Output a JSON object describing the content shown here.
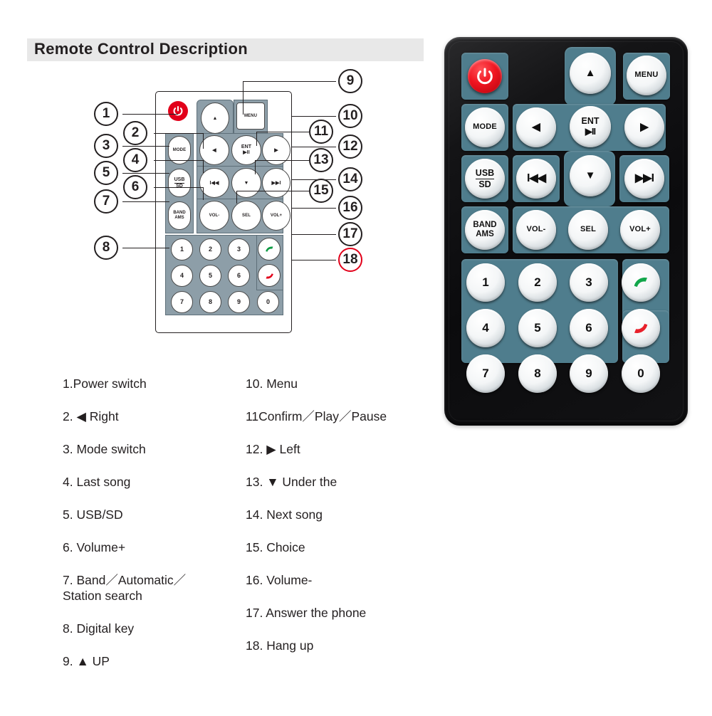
{
  "header": {
    "title": "Remote Control Description"
  },
  "lineart": {
    "buttons": {
      "power": "power-symbol",
      "up": "▲",
      "menu": "MENU",
      "mode": "MODE",
      "left": "◀",
      "ent_top": "ENT",
      "ent_bottom": "▶II",
      "right": "▶",
      "usb": "USB",
      "sd": "SD",
      "prev": "I◀◀",
      "down": "▼",
      "next": "▶▶I",
      "band": "BAND",
      "ams": "AMS",
      "vol_minus": "VOL-",
      "sel": "SEL",
      "vol_plus": "VOL+",
      "keys": [
        "1",
        "2",
        "3",
        "4",
        "5",
        "6",
        "7",
        "8",
        "9",
        "0"
      ],
      "answer": "answer-call-icon",
      "hangup": "hang-up-icon"
    },
    "callouts": [
      "1",
      "2",
      "3",
      "4",
      "5",
      "6",
      "7",
      "8",
      "9",
      "10",
      "11",
      "12",
      "13",
      "14",
      "15",
      "16",
      "17",
      "18"
    ],
    "callout_highlight": {
      "number": "18",
      "color": "#e2001a"
    }
  },
  "photo": {
    "buttons": {
      "power": "power-symbol",
      "up": "▲",
      "menu": "MENU",
      "mode": "MODE",
      "left": "◀",
      "ent_top": "ENT",
      "ent_bottom": "▶II",
      "right": "▶",
      "usb": "USB",
      "sd": "SD",
      "prev": "I◀◀",
      "down": "▼",
      "next": "▶▶I",
      "band": "BAND",
      "ams": "AMS",
      "vol_minus": "VOL-",
      "sel": "SEL",
      "vol_plus": "VOL+",
      "keys": [
        "1",
        "2",
        "3",
        "4",
        "5",
        "6",
        "7",
        "8",
        "9",
        "0"
      ],
      "answer": "answer-call-icon",
      "hangup": "hang-up-icon"
    },
    "colors": {
      "body": "#111113",
      "panel": "#4f7d8d",
      "power": "#f01420",
      "answer": "#11a64a",
      "hangup": "#e8202a"
    }
  },
  "descriptions": {
    "left": [
      "1.Power switch",
      "2. ◀ Right",
      "3. Mode switch",
      "4. Last song",
      "5. USB/SD",
      "6. Volume+",
      "7. Band／Automatic／\n    Station search",
      "8. Digital key",
      "9. ▲ UP"
    ],
    "right": [
      "10. Menu",
      "11Confirm／Play／Pause",
      "12.  ▶  Left",
      "13.  ▼  Under the",
      "14. Next song",
      "15. Choice",
      "16. Volume-",
      "17. Answer the phone",
      "18. Hang up"
    ]
  }
}
